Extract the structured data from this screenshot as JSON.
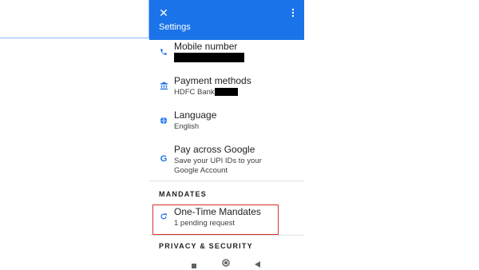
{
  "header": {
    "title": "Settings",
    "bg_color": "#1a73e8",
    "close_icon": "close-icon",
    "more_icon": "more-vert-icon"
  },
  "items": {
    "mobile": {
      "label": "Mobile number",
      "icon": "phone-icon"
    },
    "payment": {
      "label": "Payment methods",
      "sub": "HDFC Bank",
      "icon": "bank-icon"
    },
    "language": {
      "label": "Language",
      "sub": "English",
      "icon": "globe-icon"
    },
    "google": {
      "label": "Pay across Google",
      "sub1": "Save your UPI IDs to your",
      "sub2": "Google Account",
      "icon": "google-g-icon"
    }
  },
  "sections": {
    "mandates": "MANDATES",
    "privacy": "PRIVACY & SECURITY"
  },
  "mandate": {
    "label": "One-Time Mandates",
    "sub": "1 pending request",
    "icon": "refresh-icon",
    "highlight_color": "#d93025"
  },
  "navbar": {
    "recents_icon": "recents-square-icon",
    "home_icon": "home-circle-icon",
    "back_icon": "back-triangle-icon"
  }
}
